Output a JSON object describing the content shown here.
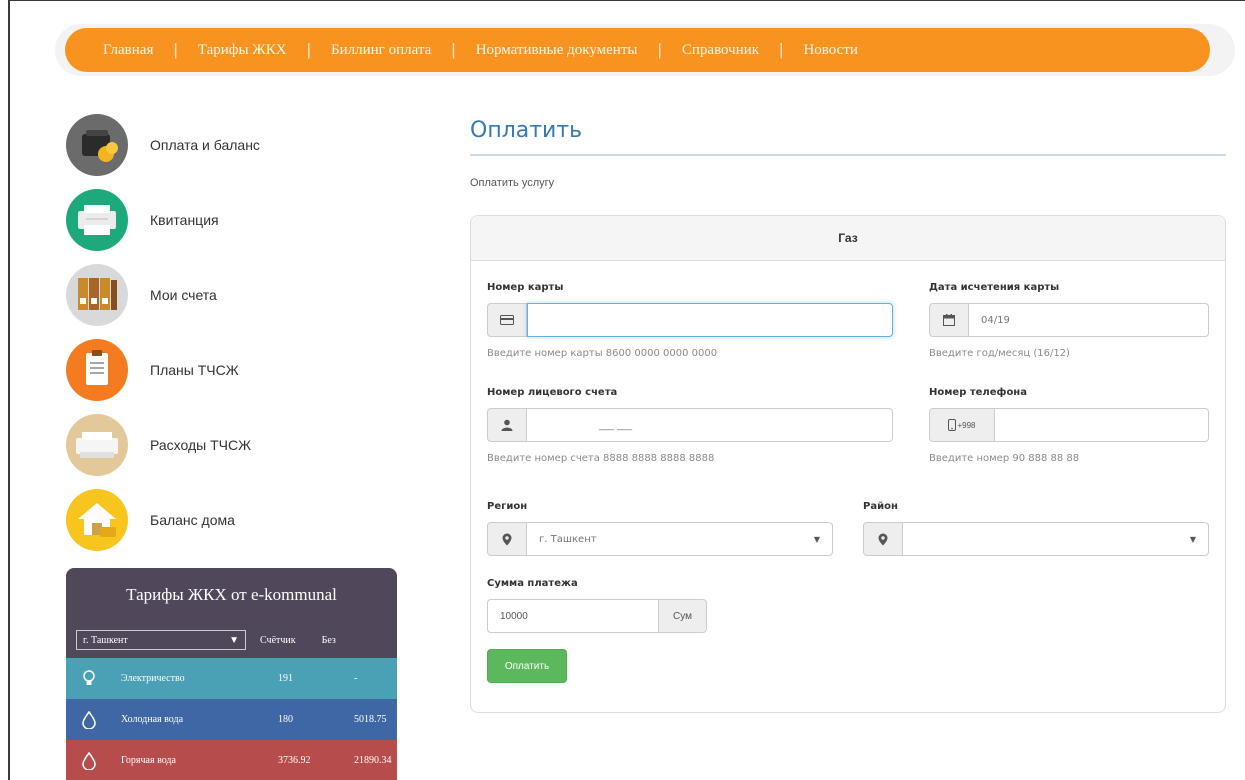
{
  "nav": {
    "items": [
      "Главная",
      "Тарифы ЖКХ",
      "Биллинг оплата",
      "Нормативные документы",
      "Справочник",
      "Новости"
    ],
    "separator": "|"
  },
  "sidebar": {
    "items": [
      {
        "label": "Оплата и баланс",
        "icon": "wallet-icon",
        "color": "#6b6b6b"
      },
      {
        "label": "Квитанция",
        "icon": "printer-icon",
        "color": "#1ea97c"
      },
      {
        "label": "Мои счета",
        "icon": "binders-icon",
        "color": "#d9d9d9"
      },
      {
        "label": "Планы ТЧСЖ",
        "icon": "clipboard-icon",
        "color": "#f47b20"
      },
      {
        "label": "Расходы ТЧСЖ",
        "icon": "receipt-icon",
        "color": "#e3c89a"
      },
      {
        "label": "Баланс дома",
        "icon": "house-icon",
        "color": "#f7c51e"
      }
    ]
  },
  "tariff": {
    "title": "Тарифы ЖКХ от e-kommunal",
    "city_select": "г. Ташкент",
    "col_meter": "Счётчик",
    "col_no_meter": "Без",
    "rows": [
      {
        "name": "Электричество",
        "meter": "191",
        "no_meter": "-",
        "icon": "lightbulb-icon",
        "color": "#4aa0b5"
      },
      {
        "name": "Холодная вода",
        "meter": "180",
        "no_meter": "5018.75",
        "icon": "water-drop-icon",
        "color": "#3f67a5"
      },
      {
        "name": "Горячая вода",
        "meter": "3736.92",
        "no_meter": "21890.34",
        "icon": "hot-water-drop-icon",
        "color": "#b64c4c"
      }
    ]
  },
  "page": {
    "title": "Оплатить",
    "subtitle": "Оплатить услугу"
  },
  "form": {
    "panel_title": "Газ",
    "card_number": {
      "label": "Номер карты",
      "value": "",
      "help": "Введите номер карты 8600 0000 0000 0000"
    },
    "card_expiry": {
      "label": "Дата исчетения карты",
      "value": "04/19",
      "help": "Введите год/месяц (16/12)"
    },
    "account": {
      "label": "Номер лицевого счета",
      "value": "___ ___",
      "help": "Введите номер счета 8888 8888 8888 8888"
    },
    "phone": {
      "label": "Номер телефона",
      "prefix": "+998",
      "value": "",
      "help": "Введите номер 90 888 88 88"
    },
    "region": {
      "label": "Регион",
      "value": "г. Ташкент"
    },
    "district": {
      "label": "Район",
      "value": ""
    },
    "amount": {
      "label": "Сумма платежа",
      "value": "10000",
      "currency": "Сум"
    },
    "submit_label": "Оплатить"
  },
  "colors": {
    "nav_orange": "#f7931e",
    "title_blue": "#337ab7",
    "submit_green": "#5cb85c",
    "tariff_header": "#51475a"
  }
}
